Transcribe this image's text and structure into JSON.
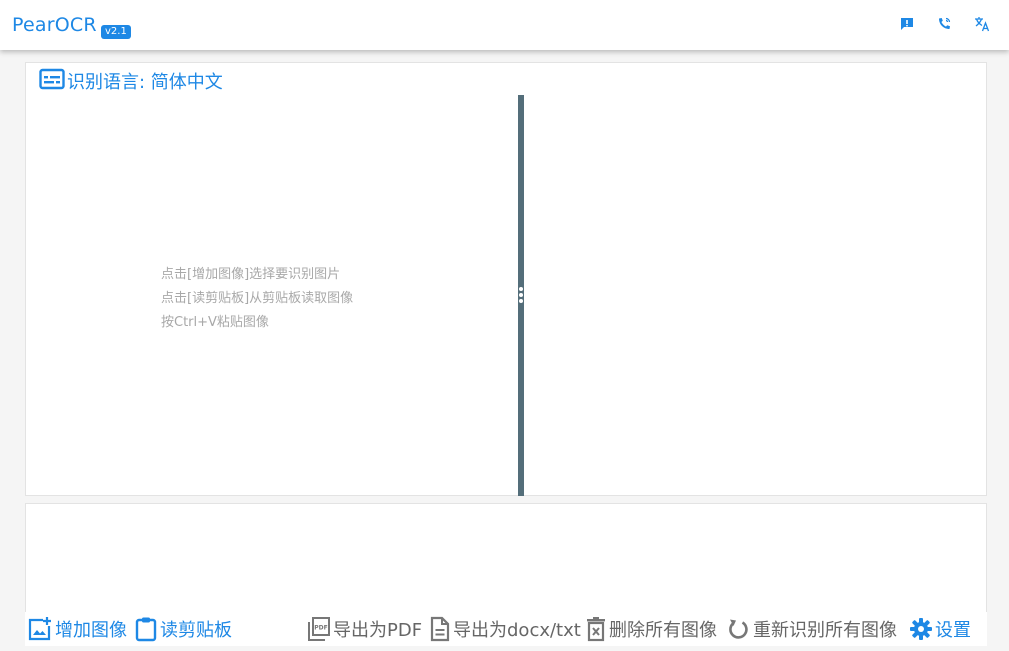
{
  "header": {
    "app_name": "PearOCR",
    "version": "v2.1",
    "icons": [
      "feedback-icon",
      "phone-icon",
      "translate-icon"
    ]
  },
  "language_bar": {
    "label": "识别语言: 简体中文",
    "icon": "subtitles-icon"
  },
  "image_pane": {
    "hints": [
      "点击[增加图像]选择要识别图片",
      "点击[读剪贴板]从剪贴板读取图像",
      "按Ctrl+V粘贴图像"
    ]
  },
  "toolbar": {
    "left": [
      {
        "label": "增加图像",
        "icon": "add-image-icon"
      },
      {
        "label": "读剪贴板",
        "icon": "clipboard-icon"
      }
    ],
    "right": [
      {
        "label": "导出为PDF",
        "icon": "pdf-icon"
      },
      {
        "label": "导出为docx/txt",
        "icon": "document-icon"
      },
      {
        "label": "删除所有图像",
        "icon": "delete-icon"
      },
      {
        "label": "重新识别所有图像",
        "icon": "refresh-icon"
      },
      {
        "label": "设置",
        "icon": "gear-icon"
      }
    ]
  },
  "colors": {
    "accent": "#1e88e5",
    "splitter": "#546e7a",
    "muted_text": "#a8a8a8",
    "secondary_text": "#666666"
  }
}
